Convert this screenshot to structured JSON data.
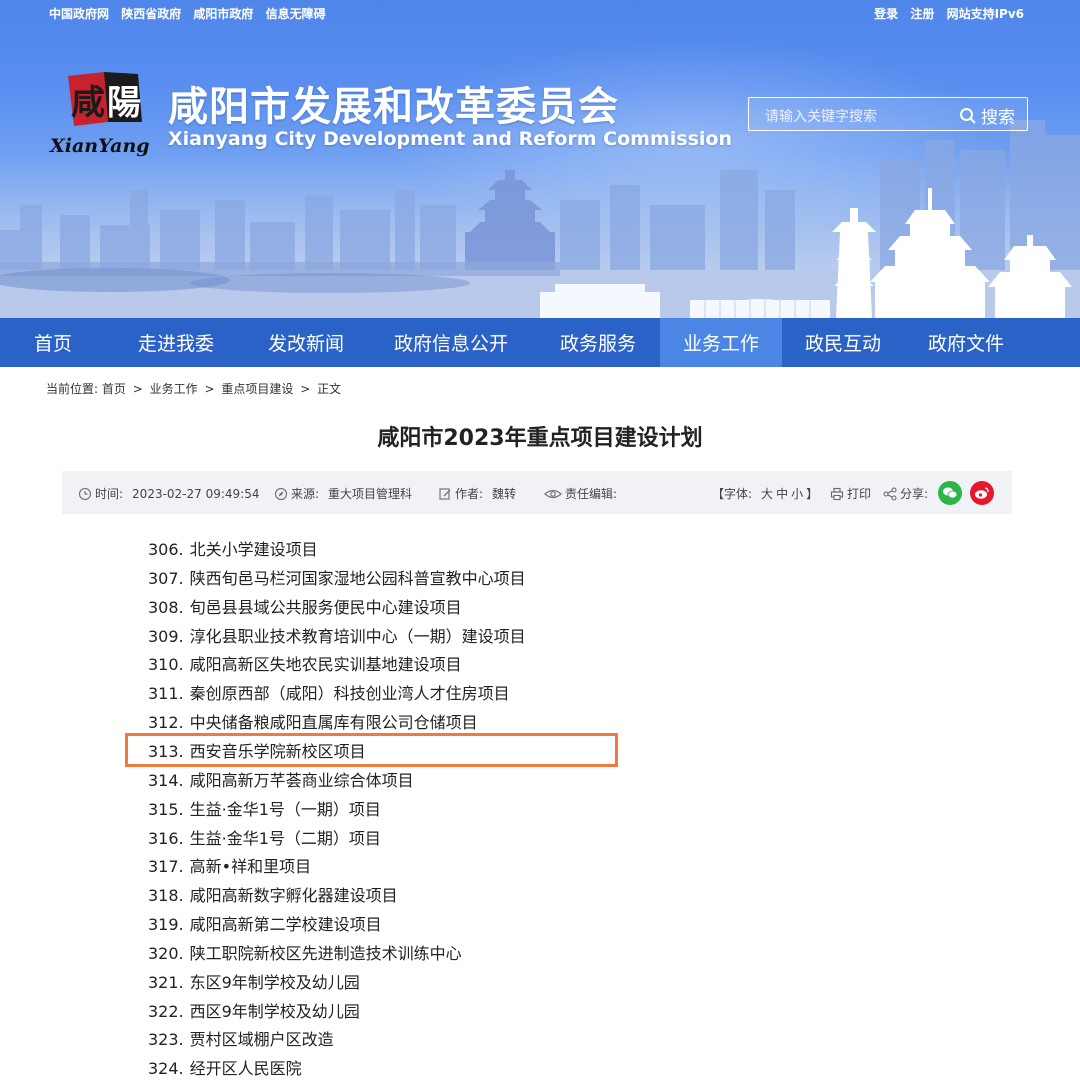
{
  "top_links": {
    "left": [
      "中国政府网",
      "陕西省政府",
      "咸阳市政府",
      "信息无障碍"
    ],
    "right": [
      "登录",
      "注册",
      "网站支持IPv6"
    ]
  },
  "logo": {
    "chars": "咸陽",
    "latin": "XianYang"
  },
  "site": {
    "title": "咸阳市发展和改革委员会",
    "subtitle": "Xianyang City Development and Reform Commission"
  },
  "search": {
    "placeholder": "请输入关键字搜索",
    "button_label": "搜索"
  },
  "nav": {
    "items": [
      "首页",
      "走进我委",
      "发改新闻",
      "政府信息公开",
      "政务服务",
      "业务工作",
      "政民互动",
      "政府文件"
    ],
    "active_index": 5
  },
  "breadcrumb": {
    "prefix": "当前位置:",
    "items": [
      "首页",
      "业务工作",
      "重点项目建设",
      "正文"
    ],
    "separator": ">"
  },
  "article": {
    "title": "咸阳市2023年重点项目建设计划",
    "meta": {
      "time_label": "时间:",
      "time_value": "2023-02-27 09:49:54",
      "source_label": "来源:",
      "source_value": "重大项目管理科",
      "author_label": "作者:",
      "author_value": "魏转",
      "editor_label": "责任编辑:",
      "font_label": "【字体:",
      "font_large": "大",
      "font_medium": "中",
      "font_small": "小",
      "font_close": "】",
      "print_label": "打印",
      "share_label": "分享:"
    },
    "items": [
      {
        "num": "306.",
        "text": "北关小学建设项目"
      },
      {
        "num": "307.",
        "text": "陕西旬邑马栏河国家湿地公园科普宣教中心项目"
      },
      {
        "num": "308.",
        "text": "旬邑县县域公共服务便民中心建设项目"
      },
      {
        "num": "309.",
        "text": "淳化县职业技术教育培训中心（一期）建设项目"
      },
      {
        "num": "310.",
        "text": "咸阳高新区失地农民实训基地建设项目"
      },
      {
        "num": "311.",
        "text": "秦创原西部（咸阳）科技创业湾人才住房项目"
      },
      {
        "num": "312.",
        "text": "中央储备粮咸阳直属库有限公司仓储项目"
      },
      {
        "num": "313.",
        "text": "西安音乐学院新校区项目"
      },
      {
        "num": "314.",
        "text": "咸阳高新万芊荟商业综合体项目"
      },
      {
        "num": "315.",
        "text": "生益·金华1号（一期）项目"
      },
      {
        "num": "316.",
        "text": "生益·金华1号（二期）项目"
      },
      {
        "num": "317.",
        "text": "高新•祥和里项目"
      },
      {
        "num": "318.",
        "text": "咸阳高新数字孵化器建设项目"
      },
      {
        "num": "319.",
        "text": "咸阳高新第二学校建设项目"
      },
      {
        "num": "320.",
        "text": "陕工职院新校区先进制造技术训练中心"
      },
      {
        "num": "321.",
        "text": "东区9年制学校及幼儿园"
      },
      {
        "num": "322.",
        "text": "西区9年制学校及幼儿园"
      },
      {
        "num": "323.",
        "text": "贾村区域棚户区改造"
      },
      {
        "num": "324.",
        "text": "经开区人民医院"
      }
    ],
    "highlighted_num": "313."
  },
  "colors": {
    "nav_bg": "#2a62c8",
    "nav_active": "#4b86e4",
    "highlight_border": "#f07a3a",
    "wechat": "#2fb44a",
    "weibo": "#e6162d"
  }
}
